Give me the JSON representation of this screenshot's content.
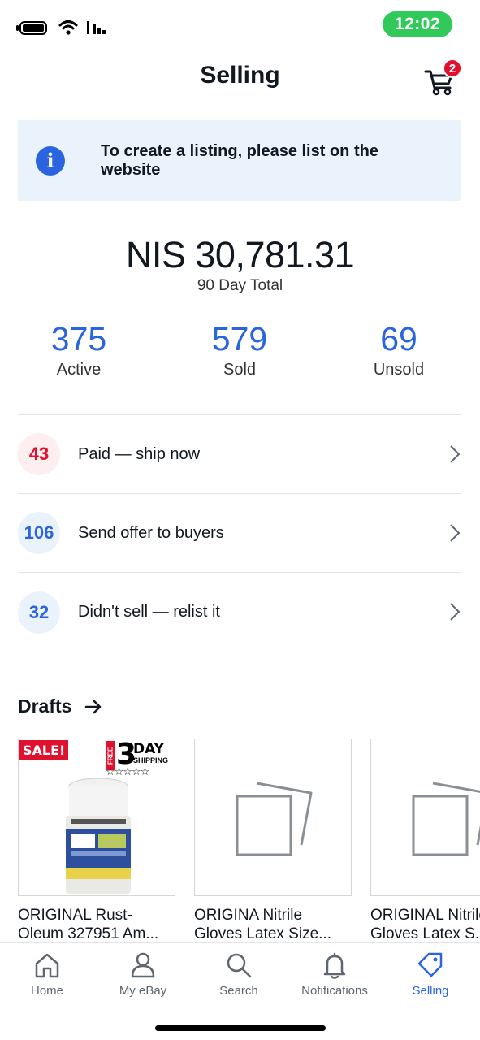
{
  "status_bar": {
    "time": "12:02"
  },
  "header": {
    "title": "Selling",
    "cart_count": "2"
  },
  "banner": {
    "icon": "info-icon",
    "glyph": "i",
    "text": "To create a listing, please list on the website"
  },
  "summary": {
    "total": "NIS 30,781.31",
    "total_label": "90 Day Total",
    "stats": [
      {
        "value": "375",
        "label": "Active"
      },
      {
        "value": "579",
        "label": "Sold"
      },
      {
        "value": "69",
        "label": "Unsold"
      }
    ]
  },
  "actions": [
    {
      "count": "43",
      "label": "Paid — ship now",
      "color": "#e0102f",
      "bg": "#fdeef0"
    },
    {
      "count": "106",
      "label": "Send offer to buyers",
      "color": "#2a65df",
      "bg": "#eaf3fc"
    },
    {
      "count": "32",
      "label": "Didn't sell — relist it",
      "color": "#2a65df",
      "bg": "#eaf3fc"
    }
  ],
  "drafts": {
    "title": "Drafts",
    "items": [
      {
        "title": "ORIGINAL Rust-Oleum 327951 Am...",
        "sale": "SALE!",
        "free": "FREE",
        "three": "3",
        "day": "DAY",
        "shipping": "SHIPPING",
        "stars": "☆☆☆☆☆"
      },
      {
        "title": "ORIGINA Nitrile Gloves Latex Size..."
      },
      {
        "title": "ORIGINAL Nitrile Gloves Latex S..."
      }
    ]
  },
  "tabs": [
    {
      "label": "Home",
      "icon": "home-icon"
    },
    {
      "label": "My eBay",
      "icon": "person-icon"
    },
    {
      "label": "Search",
      "icon": "search-icon"
    },
    {
      "label": "Notifications",
      "icon": "bell-icon"
    },
    {
      "label": "Selling",
      "icon": "tag-icon",
      "active": true
    }
  ],
  "colors": {
    "accent": "#2a65df",
    "alert": "#e0102f",
    "time_pill": "#30c95a"
  }
}
